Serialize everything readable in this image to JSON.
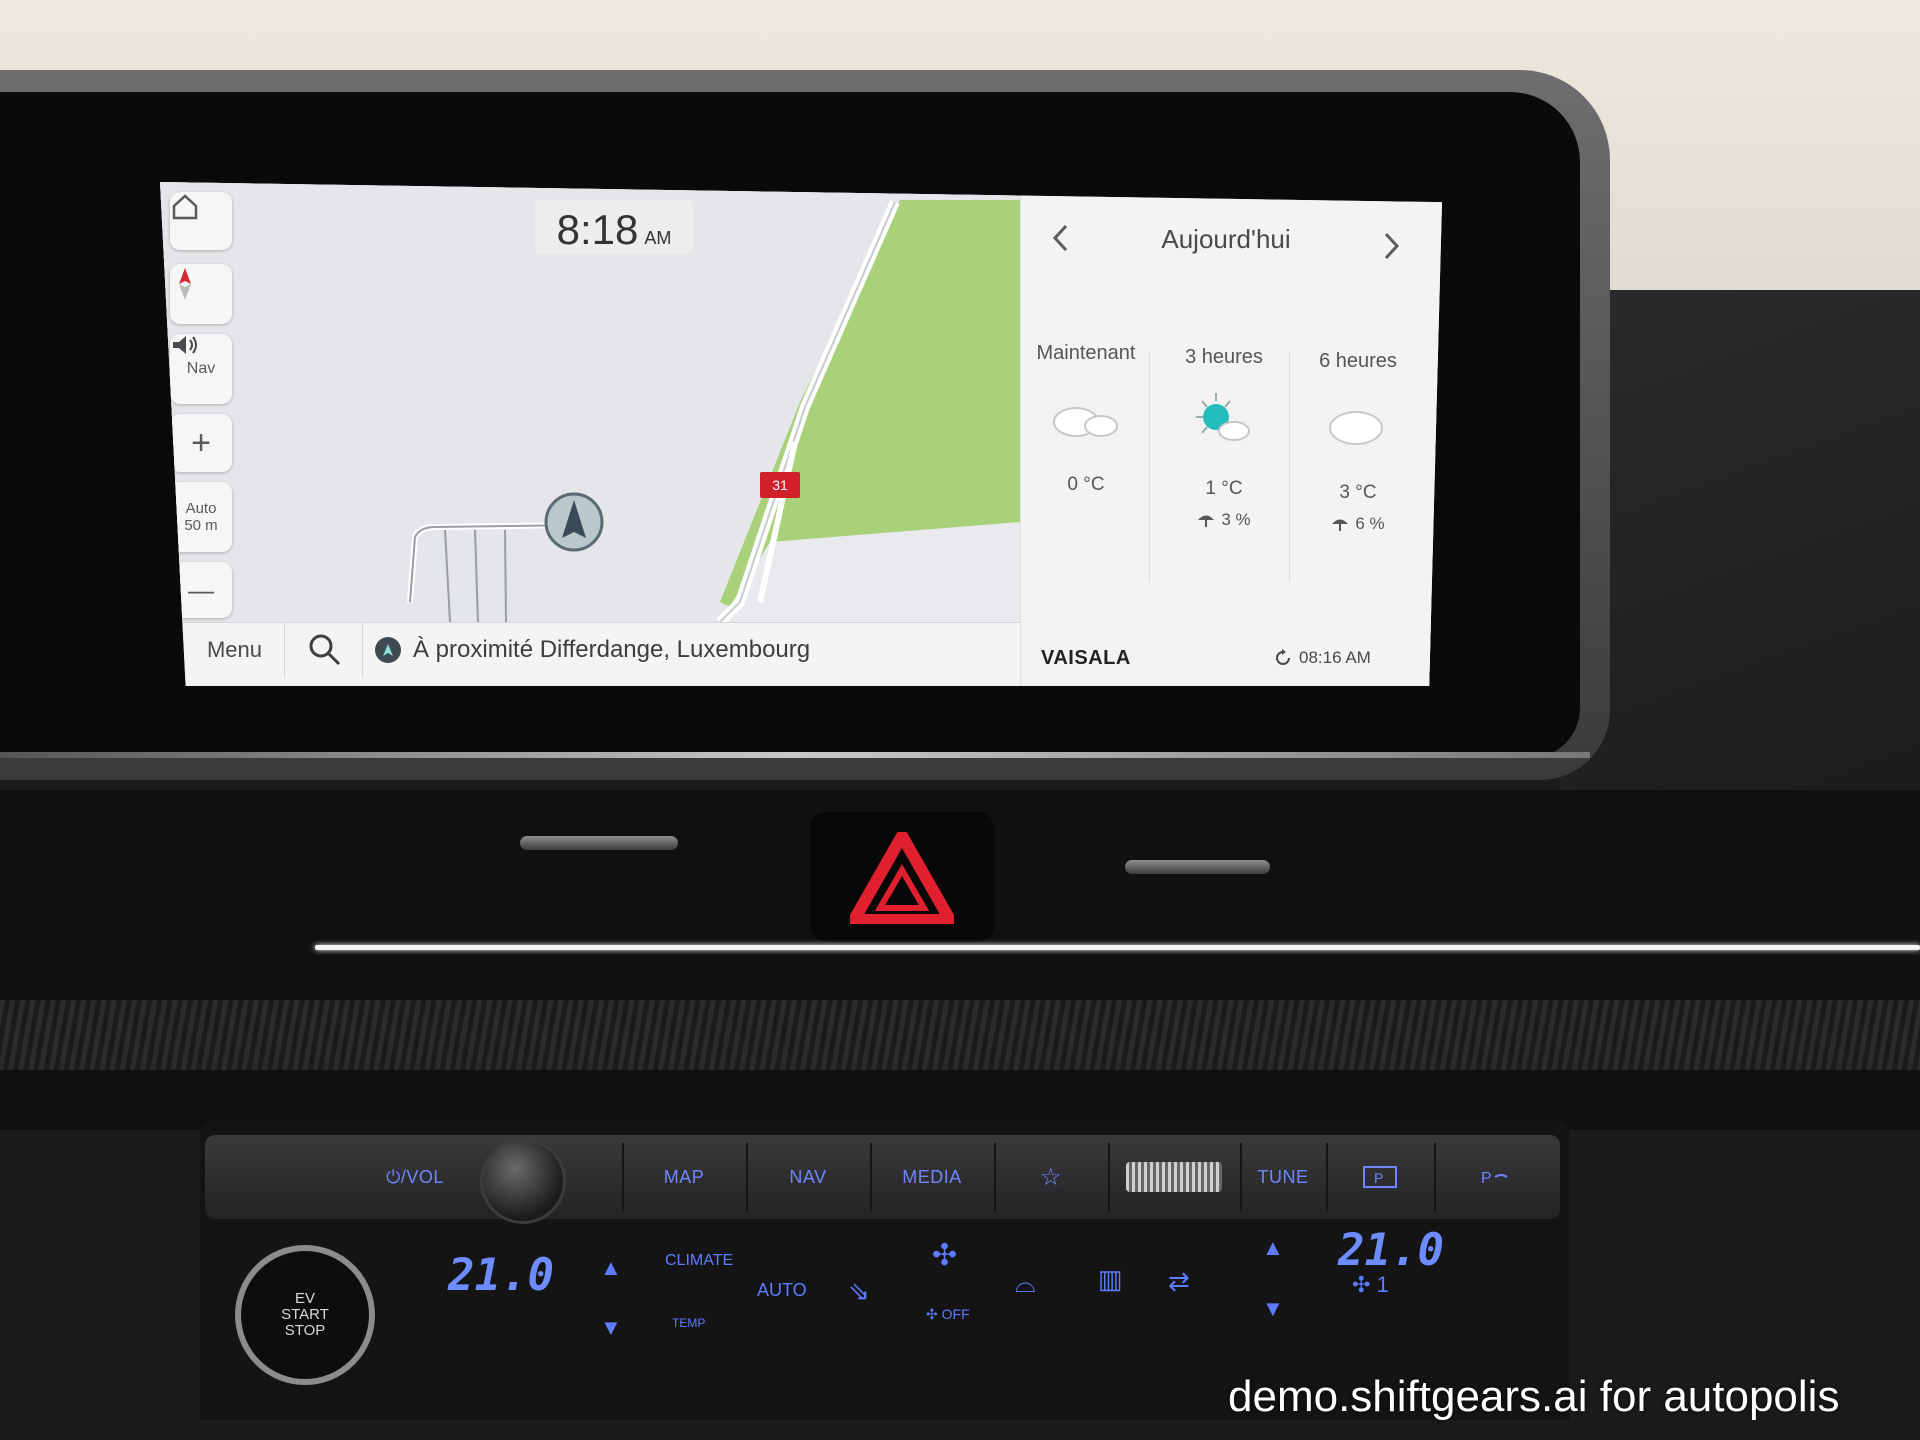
{
  "screen": {
    "clock": {
      "time": "8:18",
      "ampm": "AM"
    },
    "map_controls": {
      "nav_label": "Nav",
      "zoom_mode": "Auto",
      "zoom_scale": "50 m",
      "plus": "+",
      "minus": "—"
    },
    "road_number": "31",
    "bottom_bar": {
      "menu_label": "Menu",
      "location_text": "À proximité Differdange, Luxembourg"
    },
    "weather": {
      "title": "Aujourd'hui",
      "columns": [
        {
          "label": "Maintenant",
          "icon": "cloud-icon",
          "temp": "0 °C",
          "rain": ""
        },
        {
          "label": "3 heures",
          "icon": "sun-cloud-icon",
          "temp": "1 °C",
          "rain": "3 %"
        },
        {
          "label": "6 heures",
          "icon": "cloud-icon",
          "temp": "3 °C",
          "rain": "6 %"
        }
      ],
      "provider": "VAISALA",
      "updated_time": "08:16 AM"
    }
  },
  "hardware": {
    "vol_label": "⏻/VOL",
    "buttons": [
      "MAP",
      "NAV",
      "MEDIA",
      "☆",
      "TUNE"
    ],
    "start_button": [
      "EV",
      "START",
      "STOP"
    ],
    "climate": {
      "left_temp": "21.0",
      "right_temp": "21.0",
      "climate_label": "CLIMATE",
      "auto_label": "AUTO",
      "fan_off_label": "OFF",
      "fan_speed": "1",
      "temp_label": "TEMP"
    }
  },
  "watermark": "demo.shiftgears.ai for autopolis",
  "colors": {
    "accent_blue": "#6f86ff",
    "hazard_red": "#e1202f",
    "park_green": "#a8d17a"
  }
}
